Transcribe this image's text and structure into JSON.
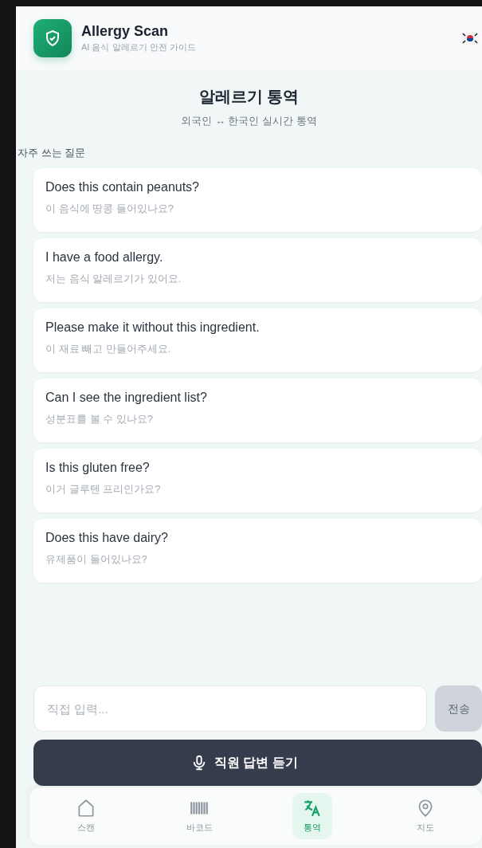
{
  "header": {
    "title": "Allergy Scan",
    "subtitle": "AI 음식 알레르기 안전 가이드"
  },
  "page": {
    "title": "알레르기 통역",
    "subtitle": "외국인 ↔ 한국인 실시간 통역"
  },
  "section_label": "자주 쓰는 질문",
  "phrases": [
    {
      "english": "Does this contain peanuts?",
      "korean": "이 음식에 땅콩 들어있나요?"
    },
    {
      "english": "I have a food allergy.",
      "korean": "저는 음식 알레르기가 있어요."
    },
    {
      "english": "Please make it without this ingredient.",
      "korean": "이 재료 빼고 만들어주세요."
    },
    {
      "english": "Can I see the ingredient list?",
      "korean": "성분표를 볼 수 있나요?"
    },
    {
      "english": "Is this gluten free?",
      "korean": "이거 글루텐 프리인가요?"
    },
    {
      "english": "Does this have dairy?",
      "korean": "유제품이 들어있나요?"
    }
  ],
  "input": {
    "placeholder": "직접 입력...",
    "send_label": "전송",
    "send_disabled": true
  },
  "listen_button": "직원 답변 듣기",
  "nav": [
    {
      "label": "스캔",
      "kind": "home",
      "selected": false
    },
    {
      "label": "바코드",
      "kind": "barcode",
      "selected": false
    },
    {
      "label": "통역",
      "kind": "translate",
      "selected": true
    },
    {
      "label": "지도",
      "kind": "pin",
      "selected": false
    }
  ]
}
